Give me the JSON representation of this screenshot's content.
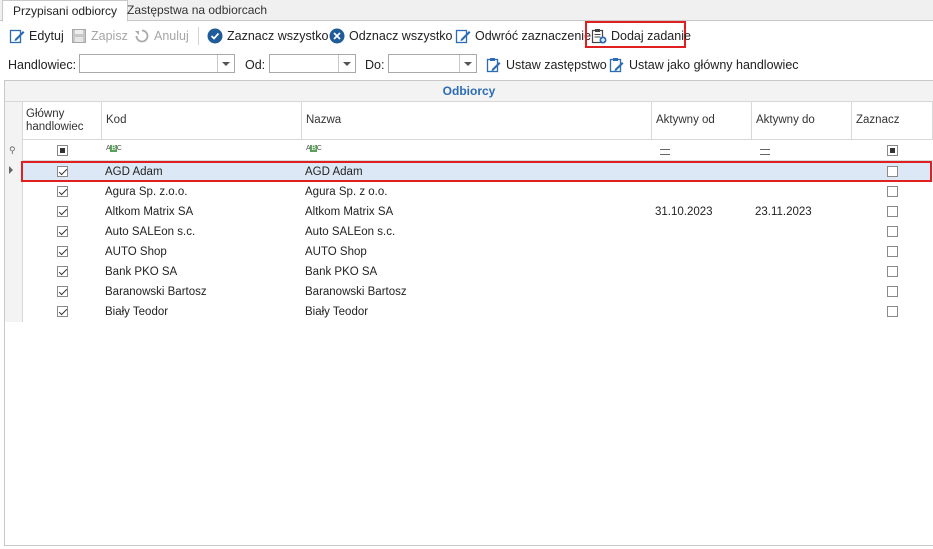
{
  "tabs": [
    {
      "label": "Przypisani odbiorcy",
      "active": true
    },
    {
      "label": "Zastępstwa na odbiorcach",
      "active": false
    }
  ],
  "toolbar": {
    "edit": "Edytuj",
    "save": "Zapisz",
    "cancel": "Anuluj",
    "select_all": "Zaznacz wszystko",
    "deselect_all": "Odznacz wszystko",
    "invert": "Odwróć zaznaczenie",
    "add_task": "Dodaj zadanie"
  },
  "filters": {
    "salesman_label": "Handlowiec:",
    "salesman_value": "",
    "from_label": "Od:",
    "from_value": "",
    "to_label": "Do:",
    "to_value": "",
    "set_substitute": "Ustaw zastępstwo",
    "set_main": "Ustaw jako główny handlowiec"
  },
  "grid": {
    "band_title": "Odbiorcy",
    "columns": [
      "Główny handlowiec",
      "Kod",
      "Nazwa",
      "Aktywny od",
      "Aktywny do",
      "Zaznacz"
    ],
    "rows": [
      {
        "main": true,
        "kod": "AGD Adam",
        "nazwa": "AGD Adam",
        "od": "",
        "do": "",
        "zaznacz": false,
        "selected": true
      },
      {
        "main": true,
        "kod": "Agura Sp. z.o.o.",
        "nazwa": "Agura Sp. z o.o.",
        "od": "",
        "do": "",
        "zaznacz": false
      },
      {
        "main": true,
        "kod": "Altkom Matrix SA",
        "nazwa": "Altkom Matrix SA",
        "od": "31.10.2023",
        "do": "23.11.2023",
        "zaznacz": false
      },
      {
        "main": true,
        "kod": "Auto SALEon s.c.",
        "nazwa": "Auto SALEon s.c.",
        "od": "",
        "do": "",
        "zaznacz": false
      },
      {
        "main": true,
        "kod": "AUTO Shop",
        "nazwa": "AUTO Shop",
        "od": "",
        "do": "",
        "zaznacz": false
      },
      {
        "main": true,
        "kod": "Bank PKO SA",
        "nazwa": "Bank PKO SA",
        "od": "",
        "do": "",
        "zaznacz": false
      },
      {
        "main": true,
        "kod": "Baranowski Bartosz",
        "nazwa": "Baranowski Bartosz",
        "od": "",
        "do": "",
        "zaznacz": false
      },
      {
        "main": true,
        "kod": "Biały Teodor",
        "nazwa": "Biały Teodor",
        "od": "",
        "do": "",
        "zaznacz": false
      }
    ]
  },
  "colors": {
    "accent": "#2b6cb5",
    "highlight": "#e02020",
    "selected_row": "#dde8f6"
  }
}
